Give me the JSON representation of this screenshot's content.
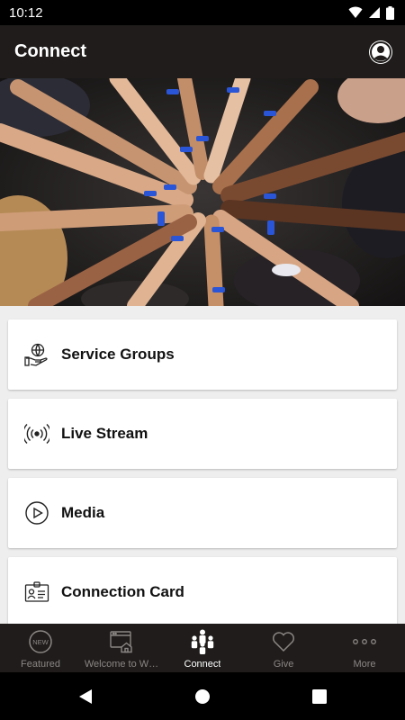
{
  "status_bar": {
    "time": "10:12"
  },
  "app_bar": {
    "title": "Connect"
  },
  "menu": [
    {
      "label": "Service Groups",
      "icon": "hand-globe-icon"
    },
    {
      "label": "Live Stream",
      "icon": "broadcast-icon"
    },
    {
      "label": "Media",
      "icon": "play-circle-icon"
    },
    {
      "label": "Connection Card",
      "icon": "id-card-icon"
    }
  ],
  "bottom_nav": [
    {
      "label": "Featured",
      "badge": "NEW",
      "active": false
    },
    {
      "label": "Welcome to W…",
      "active": false
    },
    {
      "label": "Connect",
      "active": true
    },
    {
      "label": "Give",
      "active": false
    },
    {
      "label": "More",
      "active": false
    }
  ],
  "colors": {
    "bar": "#1f1c1b",
    "inactive": "#8a8684",
    "active": "#ffffff"
  }
}
